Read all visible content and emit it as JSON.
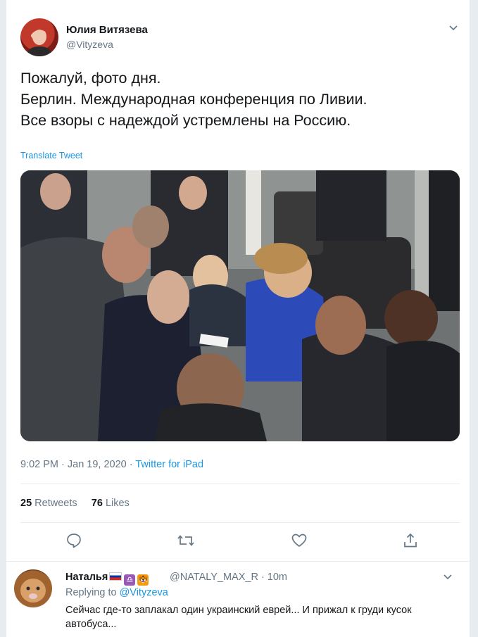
{
  "tweet": {
    "author_name": "Юлия Витязева",
    "author_handle": "@Vityzeva",
    "text": "Пожалуй, фото дня.\nБерлин. Международная конференция по Ливии.\nВсе взоры с надеждой устремлены на Россию.",
    "translate_label": "Translate Tweet",
    "timestamp": "9:02 PM · Jan 19, 2020 · ",
    "source": "Twitter for iPad",
    "retweets_count": "25",
    "retweets_label": "Retweets",
    "likes_count": "76",
    "likes_label": "Likes",
    "icons": [
      "reply-icon",
      "retweet-icon",
      "like-icon",
      "share-icon",
      "chevron-down-icon"
    ]
  },
  "reply": {
    "author_name": "Наталья",
    "badges": [
      "russian-flag",
      "libra-icon",
      "tiger-icon"
    ],
    "libra_glyph": "♎",
    "tiger_glyph": "🐯",
    "author_handle": "@NATALY_MAX_R · 10m",
    "replying_to_label": "Replying to ",
    "replying_to_handle": "@Vityzeva",
    "text": "Сейчас где-то заплакал один украинский еврей... И прижал к груди кусок автобуса..."
  },
  "colors": {
    "accent": "#1b95e0",
    "secondary_text": "#657786",
    "background": "#e6ecf0"
  }
}
